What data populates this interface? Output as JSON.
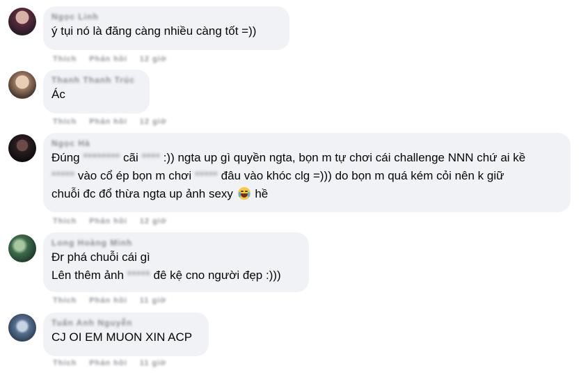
{
  "comments": [
    {
      "author": "Ngọc Linh",
      "lines": [
        [
          "ý tụi nó là đăng càng nhiều càng tốt =))"
        ]
      ],
      "actions": [
        "Thích",
        "Phản hồi",
        "12 giờ"
      ]
    },
    {
      "author": "Thanh Thanh Trúc",
      "lines": [
        [
          "Ác"
        ]
      ],
      "actions": [
        "Thích",
        "Phản hồi",
        "12 giờ"
      ]
    },
    {
      "author": "Ngọc Hà",
      "lines": [
        [
          "Đúng ",
          "********",
          " cãi ",
          "****",
          " :)) ngta up gì quyền ngta, bọn m tự chơi cái challenge NNN chứ ai kề"
        ],
        [
          "",
          "*****",
          " vào cổ ép bọn m chơi ",
          "*****",
          " đâu vào khóc clg =))) do bọn m quá kém cỏi nên k giữ"
        ],
        [
          "chuỗi đc đổ thừa ngta up ảnh sexy ",
          "",
          " hề"
        ]
      ],
      "emoji": "face-with-tears-of-joy-emoji",
      "actions": [
        "Thích",
        "Phản hồi",
        "12 giờ"
      ]
    },
    {
      "author": "Long Hoàng Minh",
      "lines": [
        [
          "Đr phá chuỗi cái gì"
        ],
        [
          "Lên thêm ảnh ",
          "*****",
          " đê kệ cno người đẹp :)))"
        ]
      ],
      "actions": [
        "Thích",
        "Phản hồi",
        "11 giờ"
      ]
    },
    {
      "author": "Tuấn Anh Nguyễn",
      "lines": [
        [
          "CJ OI EM MUON XIN ACP"
        ]
      ],
      "actions": [
        "Thích",
        "Phản hồi",
        "11 giờ"
      ]
    }
  ],
  "colors": {
    "bubble": "#f0f2f5",
    "text": "#050505",
    "meta": "#8a8d91"
  }
}
